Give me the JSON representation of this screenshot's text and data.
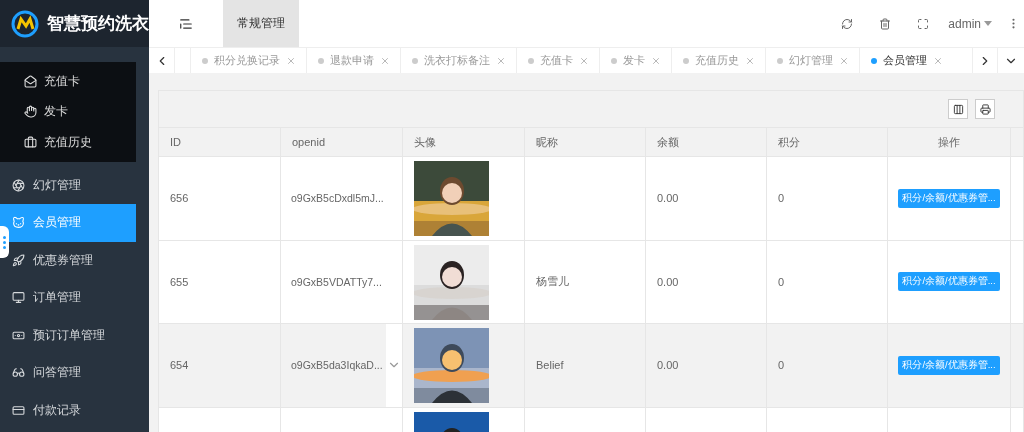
{
  "app": {
    "title": "智慧预约洗衣"
  },
  "sidebar": {
    "submenu": [
      {
        "label": "充值卡",
        "selected": false
      },
      {
        "label": "发卡",
        "selected": false
      },
      {
        "label": "充值历史",
        "selected": false
      }
    ],
    "items": [
      {
        "label": "幻灯管理",
        "selected": false
      },
      {
        "label": "会员管理",
        "selected": true
      },
      {
        "label": "优惠券管理",
        "selected": false
      },
      {
        "label": "订单管理",
        "selected": false
      },
      {
        "label": "预订订单管理",
        "selected": false
      },
      {
        "label": "问答管理",
        "selected": false
      },
      {
        "label": "付款记录",
        "selected": false
      }
    ]
  },
  "header": {
    "menus": [
      {
        "label": "常规管理",
        "selected": true
      }
    ],
    "user": "admin"
  },
  "tabs": [
    {
      "label": "积分兑换记录",
      "selected": false
    },
    {
      "label": "退款申请",
      "selected": false
    },
    {
      "label": "洗衣打标备注",
      "selected": false
    },
    {
      "label": "充值卡",
      "selected": false
    },
    {
      "label": "发卡",
      "selected": false
    },
    {
      "label": "充值历史",
      "selected": false
    },
    {
      "label": "幻灯管理",
      "selected": false
    },
    {
      "label": "会员管理",
      "selected": true
    }
  ],
  "table": {
    "columns": [
      "ID",
      "openid",
      "头像",
      "昵称",
      "余额",
      "积分",
      "操作"
    ],
    "rows": [
      {
        "id": "656",
        "openid": "o9GxB5cDxdl5mJ...",
        "balance": "0.00",
        "points": "0",
        "action": "积分/余额/优惠券管...",
        "hovered": false
      },
      {
        "id": "655",
        "openid": "o9GxB5VDATTy7...",
        "nickname": "杨雪儿",
        "balance": "0.00",
        "points": "0",
        "action": "积分/余额/优惠券管...",
        "hovered": false
      },
      {
        "id": "654",
        "openid": "o9GxB5da3IqkaD...",
        "nickname": "Belief",
        "balance": "0.00",
        "points": "0",
        "action": "积分/余额/优惠券管...",
        "hovered": true
      },
      {
        "hovered": false
      }
    ]
  }
}
